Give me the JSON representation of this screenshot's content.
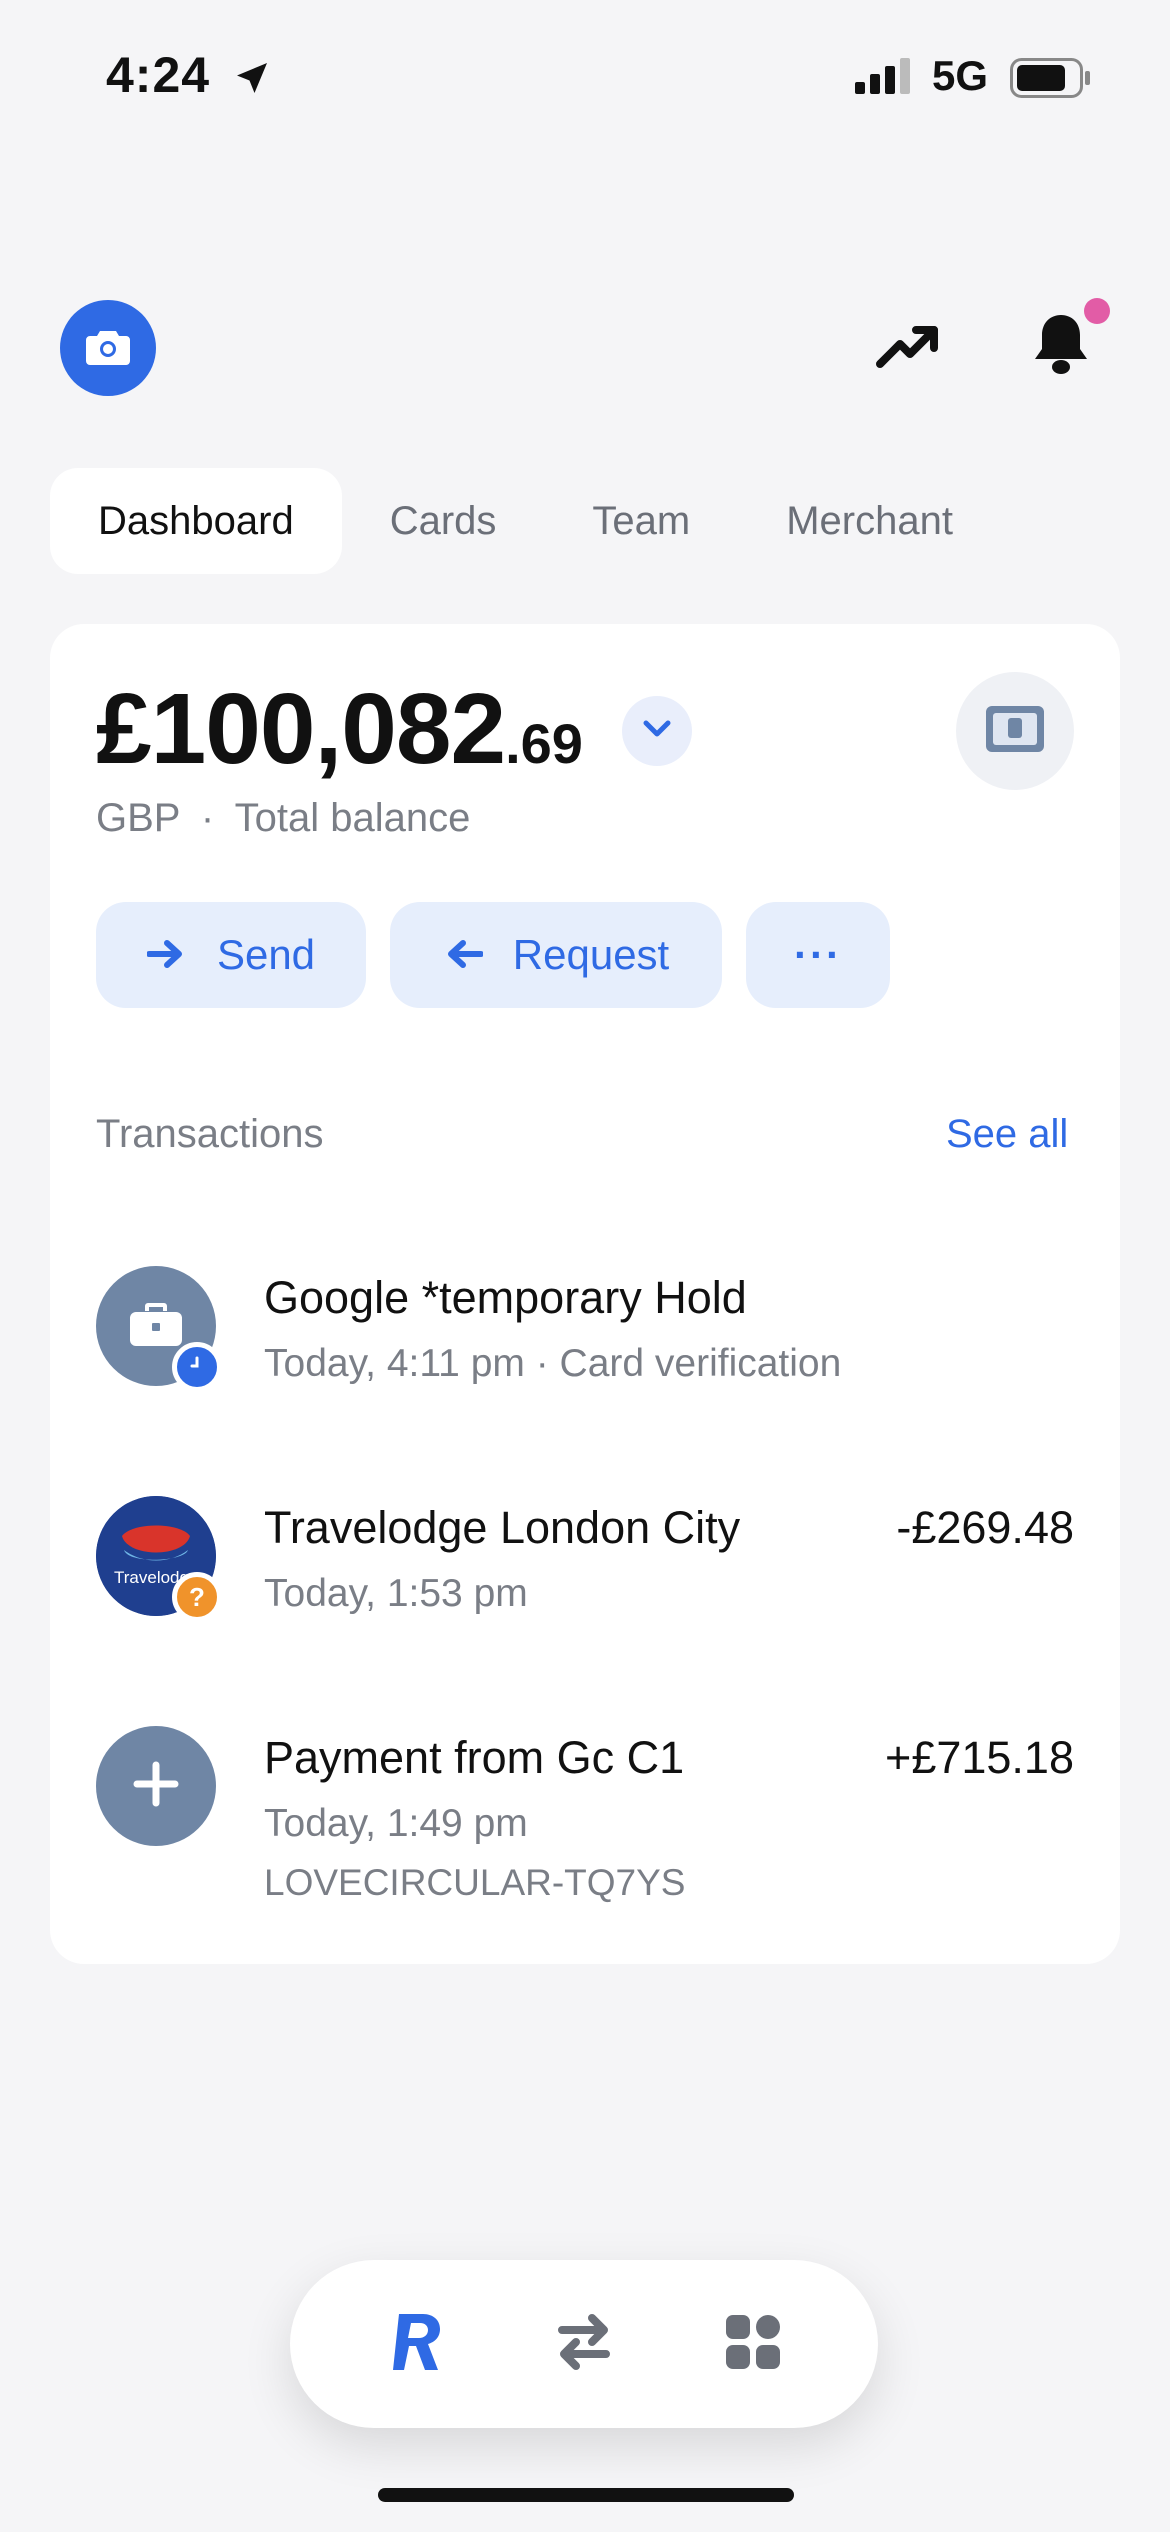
{
  "status_bar": {
    "time": "4:24",
    "network": "5G"
  },
  "tabs": [
    {
      "label": "Dashboard",
      "active": true
    },
    {
      "label": "Cards",
      "active": false
    },
    {
      "label": "Team",
      "active": false
    },
    {
      "label": "Merchant",
      "active": false
    }
  ],
  "balance": {
    "main": "£100,082",
    "cents": ".69",
    "currency": "GBP",
    "separator": "·",
    "label": "Total balance"
  },
  "actions": {
    "send": "Send",
    "request": "Request",
    "more": "···"
  },
  "transactions": {
    "title": "Transactions",
    "see_all": "See all",
    "items": [
      {
        "name": "Google *temporary Hold",
        "meta": "Today, 4:11 pm · Card verification",
        "amount": "",
        "extra": ""
      },
      {
        "name": "Travelodge London City",
        "meta": "Today, 1:53 pm",
        "amount": "-£269.48",
        "extra": "",
        "logo_text": "Travelodge"
      },
      {
        "name": "Payment from Gc C1",
        "meta": "Today, 1:49 pm",
        "amount": "+£715.18",
        "extra": "LOVECIRCULAR-TQ7YS"
      }
    ]
  },
  "colors": {
    "accent": "#2f6ae4",
    "notification": "#e25ca6",
    "pending_badge": "#f0932b",
    "avatar_gray": "#6f86a5"
  },
  "icons": {
    "camera": "camera-icon",
    "trend": "trending-up-icon",
    "bell": "bell-icon",
    "card": "card-icon",
    "nav_home": "revolut-r-icon",
    "nav_transfers": "transfer-arrows-icon",
    "nav_hub": "apps-grid-icon"
  }
}
